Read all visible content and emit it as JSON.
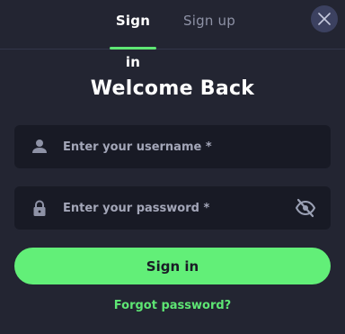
{
  "tabs": {
    "signin_label": "Sign in",
    "signup_label": "Sign up",
    "active": "signin"
  },
  "close_button": {
    "icon": "close-icon"
  },
  "title": "Welcome Back",
  "username": {
    "placeholder": "Enter your username *",
    "value": "",
    "icon": "user-icon"
  },
  "password": {
    "placeholder": "Enter your password *",
    "value": "",
    "icon": "lock-icon",
    "toggle_icon": "eye-off-icon"
  },
  "submit_label": "Sign in",
  "forgot_label": "Forgot password?",
  "colors": {
    "background": "#232532",
    "field_background": "#181a25",
    "accent": "#62ef78",
    "muted_text": "#8e92a6"
  }
}
